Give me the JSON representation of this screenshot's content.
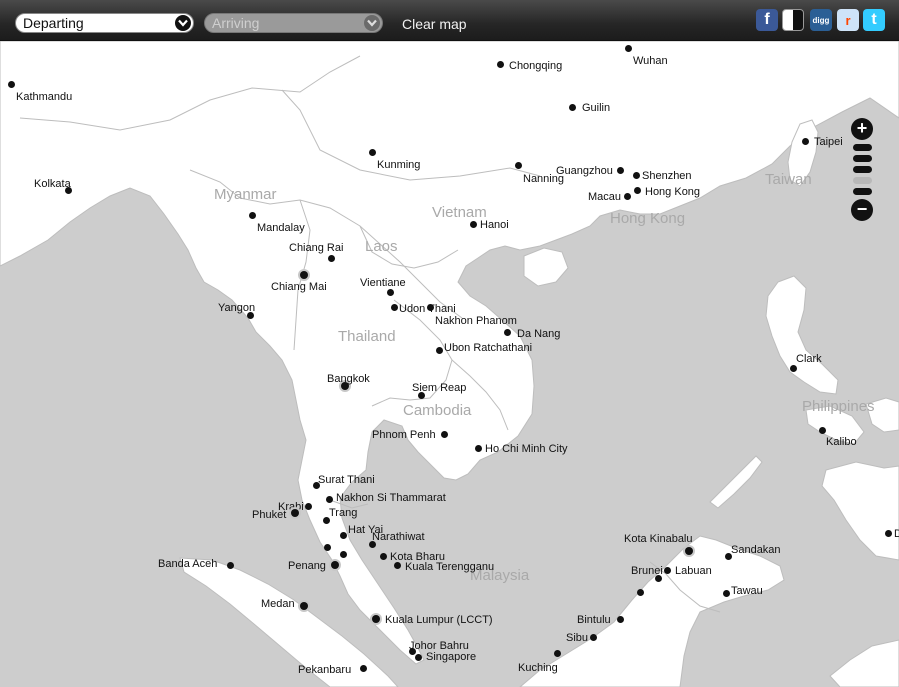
{
  "toolbar": {
    "departing_value": "Departing",
    "arriving_placeholder": "Arriving",
    "clear_label": "Clear map",
    "social": [
      {
        "name": "facebook-icon",
        "glyph": "f",
        "color": "#3b5998"
      },
      {
        "name": "delicious-icon",
        "glyph": "",
        "color": "#ffffff"
      },
      {
        "name": "digg-icon",
        "glyph": "digg",
        "color": "#2b5f95"
      },
      {
        "name": "reddit-icon",
        "glyph": "r",
        "color": "#cee3f8"
      },
      {
        "name": "twitter-icon",
        "glyph": "t",
        "color": "#33ccff"
      }
    ]
  },
  "zoom": {
    "in_label": "+",
    "out_label": "−",
    "level_of_five": 3
  },
  "countries": [
    "Myanmar",
    "Laos",
    "Vietnam",
    "Thailand",
    "Cambodia",
    "Taiwan",
    "Hong Kong",
    "Philippines",
    "Malaysia"
  ],
  "cities": [
    "Wuhan",
    "Chongqing",
    "Kathmandu",
    "Guilin",
    "Taipei",
    "Kunming",
    "Guangzhou",
    "Shenzhen",
    "Nanning",
    "Macau",
    "Hong Kong",
    "Kolkata",
    "Mandalay",
    "Hanoi",
    "Chiang Rai",
    "Chiang Mai",
    "Vientiane",
    "Udon Thani",
    "Nakhon Phanom",
    "Yangon",
    "Da Nang",
    "Ubon Ratchathani",
    "Clark",
    "Bangkok",
    "Siem Reap",
    "Kalibo",
    "Phnom Penh",
    "Ho Chi Minh City",
    "Surat Thani",
    "Nakhon Si Thammarat",
    "Krabi",
    "Phuket",
    "Trang",
    "Hat Yai",
    "Narathiwat",
    "Kota Kinabalu",
    "Kota Bharu",
    "Sandakan",
    "Banda Aceh",
    "Penang",
    "Kuala Terengganu",
    "Brunei",
    "Labuan",
    "Tawau",
    "Medan",
    "Kuala Lumpur (LCCT)",
    "Bintulu",
    "Sibu",
    "Johor Bahru",
    "Singapore",
    "Kuching",
    "Pekanbaru",
    "D"
  ]
}
